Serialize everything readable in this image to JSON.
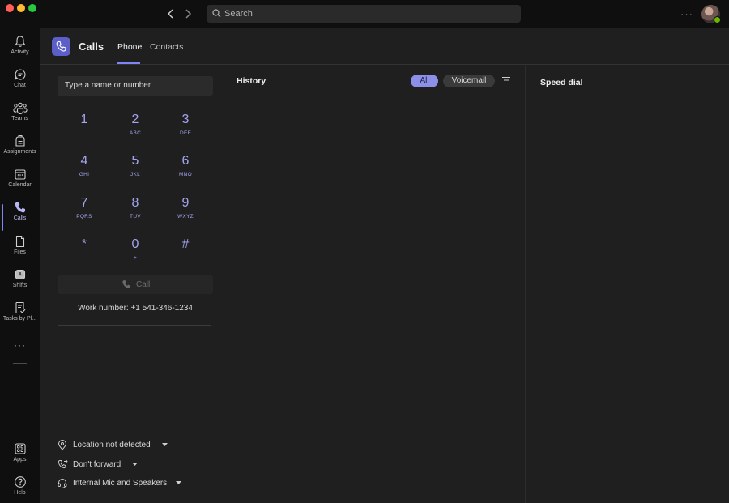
{
  "titlebar": {
    "search_placeholder": "Search",
    "more_icon": "more-horizontal-icon",
    "colors": {
      "close": "#ff5f57",
      "minimize": "#febc2e",
      "zoom": "#28c840"
    }
  },
  "rail": {
    "items": [
      {
        "label": "Activity",
        "icon": "bell-icon"
      },
      {
        "label": "Chat",
        "icon": "chat-icon"
      },
      {
        "label": "Teams",
        "icon": "teams-icon"
      },
      {
        "label": "Assignments",
        "icon": "assignments-icon"
      },
      {
        "label": "Calendar",
        "icon": "calendar-icon"
      },
      {
        "label": "Calls",
        "icon": "phone-icon",
        "active": true
      },
      {
        "label": "Files",
        "icon": "file-icon"
      },
      {
        "label": "Shifts",
        "icon": "shifts-icon"
      },
      {
        "label": "Tasks by Pl...",
        "icon": "tasks-icon"
      }
    ],
    "more": "···",
    "bottom_items": [
      {
        "label": "Apps",
        "icon": "apps-icon"
      },
      {
        "label": "Help",
        "icon": "help-icon"
      }
    ]
  },
  "header": {
    "title": "Calls",
    "tabs": [
      {
        "label": "Phone",
        "active": true
      },
      {
        "label": "Contacts"
      }
    ]
  },
  "dialpad": {
    "input_placeholder": "Type a name or number",
    "keys": [
      {
        "digit": "1",
        "letters": ""
      },
      {
        "digit": "2",
        "letters": "ABC"
      },
      {
        "digit": "3",
        "letters": "DEF"
      },
      {
        "digit": "4",
        "letters": "GHI"
      },
      {
        "digit": "5",
        "letters": "JKL"
      },
      {
        "digit": "6",
        "letters": "MNO"
      },
      {
        "digit": "7",
        "letters": "PQRS"
      },
      {
        "digit": "8",
        "letters": "TUV"
      },
      {
        "digit": "9",
        "letters": "WXYZ"
      },
      {
        "digit": "*",
        "letters": ""
      },
      {
        "digit": "0",
        "letters": "+"
      },
      {
        "digit": "#",
        "letters": ""
      }
    ],
    "call_label": "Call",
    "work_number": "Work number: +1 541-346-1234"
  },
  "options": [
    {
      "label": "Location not detected",
      "icon": "location-icon"
    },
    {
      "label": "Don't forward",
      "icon": "forward-icon"
    },
    {
      "label": "Internal Mic and Speakers",
      "icon": "headset-icon"
    }
  ],
  "history": {
    "title": "History",
    "filters": [
      {
        "label": "All",
        "active": true
      },
      {
        "label": "Voicemail"
      }
    ]
  },
  "speed_dial": {
    "title": "Speed dial"
  },
  "colors": {
    "accent": "#7f85f5",
    "brand": "#5b5fc7",
    "presence": "#6bb700"
  }
}
